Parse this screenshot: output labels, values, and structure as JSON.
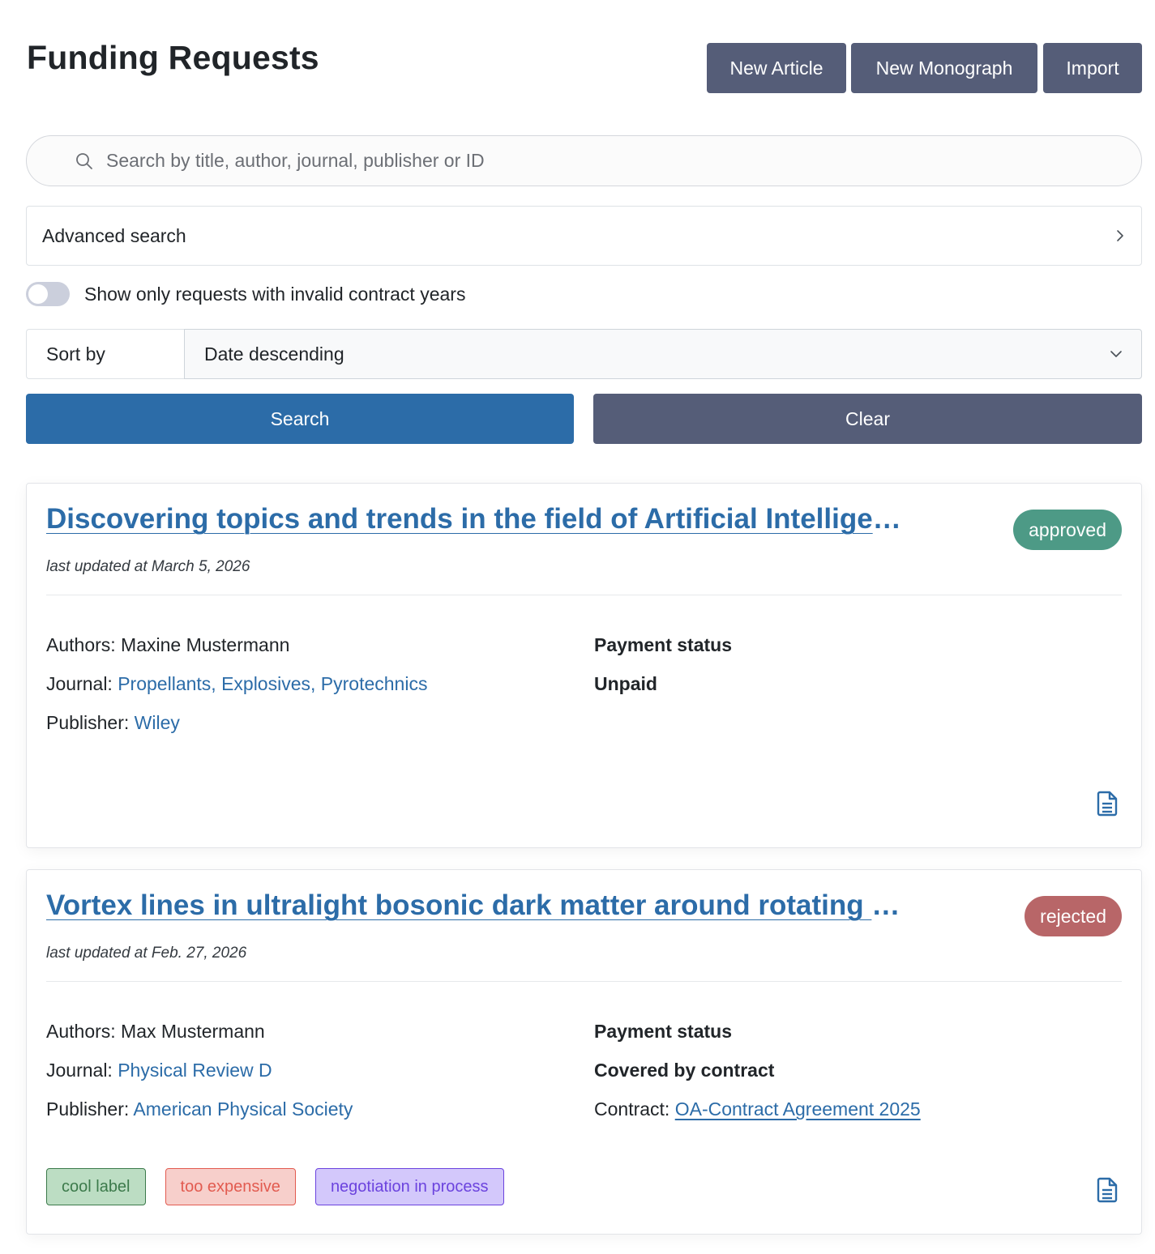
{
  "header": {
    "title": "Funding Requests",
    "new_article_label": "New Article",
    "new_monograph_label": "New Monograph",
    "import_label": "Import"
  },
  "search": {
    "placeholder": "Search by title, author, journal, publisher or ID",
    "value": ""
  },
  "advanced_search": {
    "label": "Advanced search"
  },
  "filter_toggle": {
    "label": "Show only requests with invalid contract years",
    "checked": false
  },
  "sort": {
    "label": "Sort by",
    "selected": "Date descending"
  },
  "actions": {
    "search_label": "Search",
    "clear_label": "Clear"
  },
  "colors": {
    "primary": "#2c6ca8",
    "secondary": "#555d78",
    "approved": "#4d9a86",
    "rejected": "#b86668"
  },
  "requests": [
    {
      "title": "Discovering topics and trends in the field of Artificial Intelligence",
      "status": "approved",
      "updated": "last updated at March 5, 2026",
      "authors_label": "Authors:",
      "authors": "Maxine Mustermann",
      "journal_label": "Journal:",
      "journal": "Propellants, Explosives, Pyrotechnics",
      "publisher_label": "Publisher:",
      "publisher": "Wiley",
      "payment_status_label": "Payment status",
      "payment_status": "Unpaid",
      "icon": "document-icon"
    },
    {
      "title": "Vortex lines in ultralight bosonic dark matter around rotating black holes",
      "status": "rejected",
      "updated": "last updated at Feb. 27, 2026",
      "authors_label": "Authors:",
      "authors": "Max Mustermann",
      "journal_label": "Journal:",
      "journal": "Physical Review D",
      "publisher_label": "Publisher:",
      "publisher": "American Physical Society",
      "payment_status_label": "Payment status",
      "payment_status": "Covered by contract",
      "contract_label": "Contract:",
      "contract": "OA-Contract Agreement 2025",
      "labels": [
        "cool label",
        "too expensive",
        "negotiation in process"
      ],
      "icon": "document-icon"
    }
  ]
}
